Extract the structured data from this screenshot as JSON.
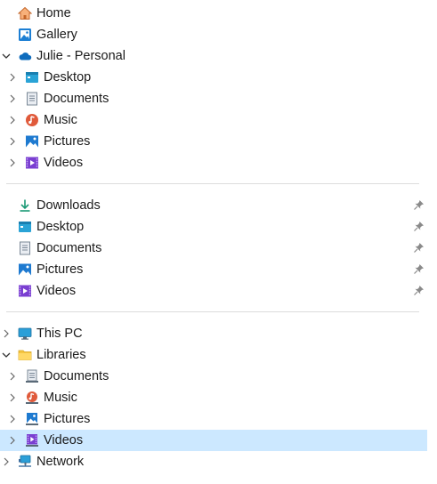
{
  "nav": {
    "top": [
      {
        "label": "Home",
        "icon": "home-icon"
      },
      {
        "label": "Gallery",
        "icon": "gallery-icon"
      },
      {
        "label": "Julie - Personal",
        "icon": "onedrive-cloud-icon",
        "expanded": true
      },
      {
        "label": "Desktop",
        "icon": "desktop-folder-icon"
      },
      {
        "label": "Documents",
        "icon": "documents-folder-icon"
      },
      {
        "label": "Music",
        "icon": "music-folder-icon"
      },
      {
        "label": "Pictures",
        "icon": "pictures-folder-icon"
      },
      {
        "label": "Videos",
        "icon": "videos-folder-icon"
      }
    ],
    "quick_access": [
      {
        "label": "Downloads",
        "icon": "downloads-icon",
        "pinned": true
      },
      {
        "label": "Desktop",
        "icon": "desktop-folder-icon",
        "pinned": true
      },
      {
        "label": "Documents",
        "icon": "documents-folder-icon",
        "pinned": true
      },
      {
        "label": "Pictures",
        "icon": "pictures-folder-icon",
        "pinned": true
      },
      {
        "label": "Videos",
        "icon": "videos-folder-icon",
        "pinned": true
      }
    ],
    "devices": [
      {
        "label": "This PC",
        "icon": "this-pc-icon",
        "expanded": false
      },
      {
        "label": "Libraries",
        "icon": "libraries-folder-icon",
        "expanded": true
      },
      {
        "label": "Documents",
        "icon": "documents-library-icon"
      },
      {
        "label": "Music",
        "icon": "music-library-icon"
      },
      {
        "label": "Pictures",
        "icon": "pictures-library-icon"
      },
      {
        "label": "Videos",
        "icon": "videos-library-icon",
        "selected": true
      },
      {
        "label": "Network",
        "icon": "network-icon",
        "expanded": false
      }
    ]
  },
  "colors": {
    "selected_row": "#cce8ff",
    "accent": "#0078d4"
  }
}
